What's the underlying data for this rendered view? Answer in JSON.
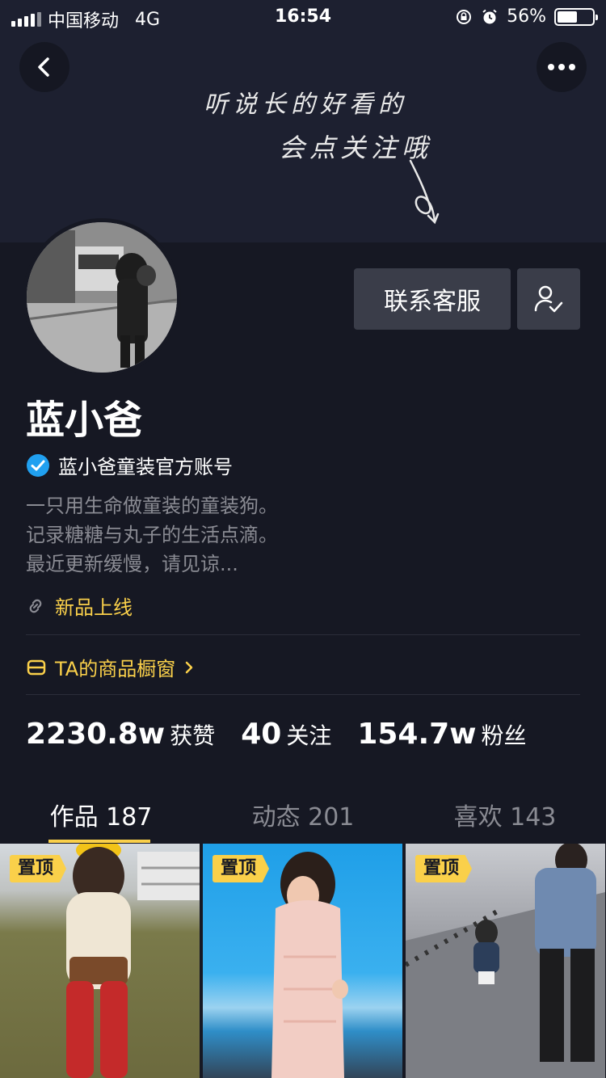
{
  "status_bar": {
    "carrier": "中国移动",
    "network": "4G",
    "time": "16:54",
    "battery": "56%",
    "battery_level": 0.56
  },
  "banner": {
    "line1": "听说长的好看的",
    "line2": "会点关注哦"
  },
  "profile": {
    "name": "蓝小爸",
    "verified_label": "蓝小爸童装官方账号",
    "bio": [
      "一只用生命做童装的童装狗。",
      "记录糖糖与丸子的生活点滴。",
      "最近更新缓慢，请见谅..."
    ],
    "link_label": "新品上线",
    "shop_label": "TA的商品橱窗"
  },
  "actions": {
    "contact_label": "联系客服"
  },
  "stats": [
    {
      "num": "2230.8w",
      "label": "获赞"
    },
    {
      "num": "40",
      "label": "关注"
    },
    {
      "num": "154.7w",
      "label": "粉丝"
    }
  ],
  "tabs": [
    {
      "label": "作品 187"
    },
    {
      "label": "动态 201"
    },
    {
      "label": "喜欢 143"
    }
  ],
  "videos": [
    {
      "badge": "置顶"
    },
    {
      "badge": "置顶"
    },
    {
      "badge": "置顶"
    }
  ],
  "colors": {
    "background": "#161823",
    "accent": "#fad04a",
    "verified": "#20a0f0"
  }
}
